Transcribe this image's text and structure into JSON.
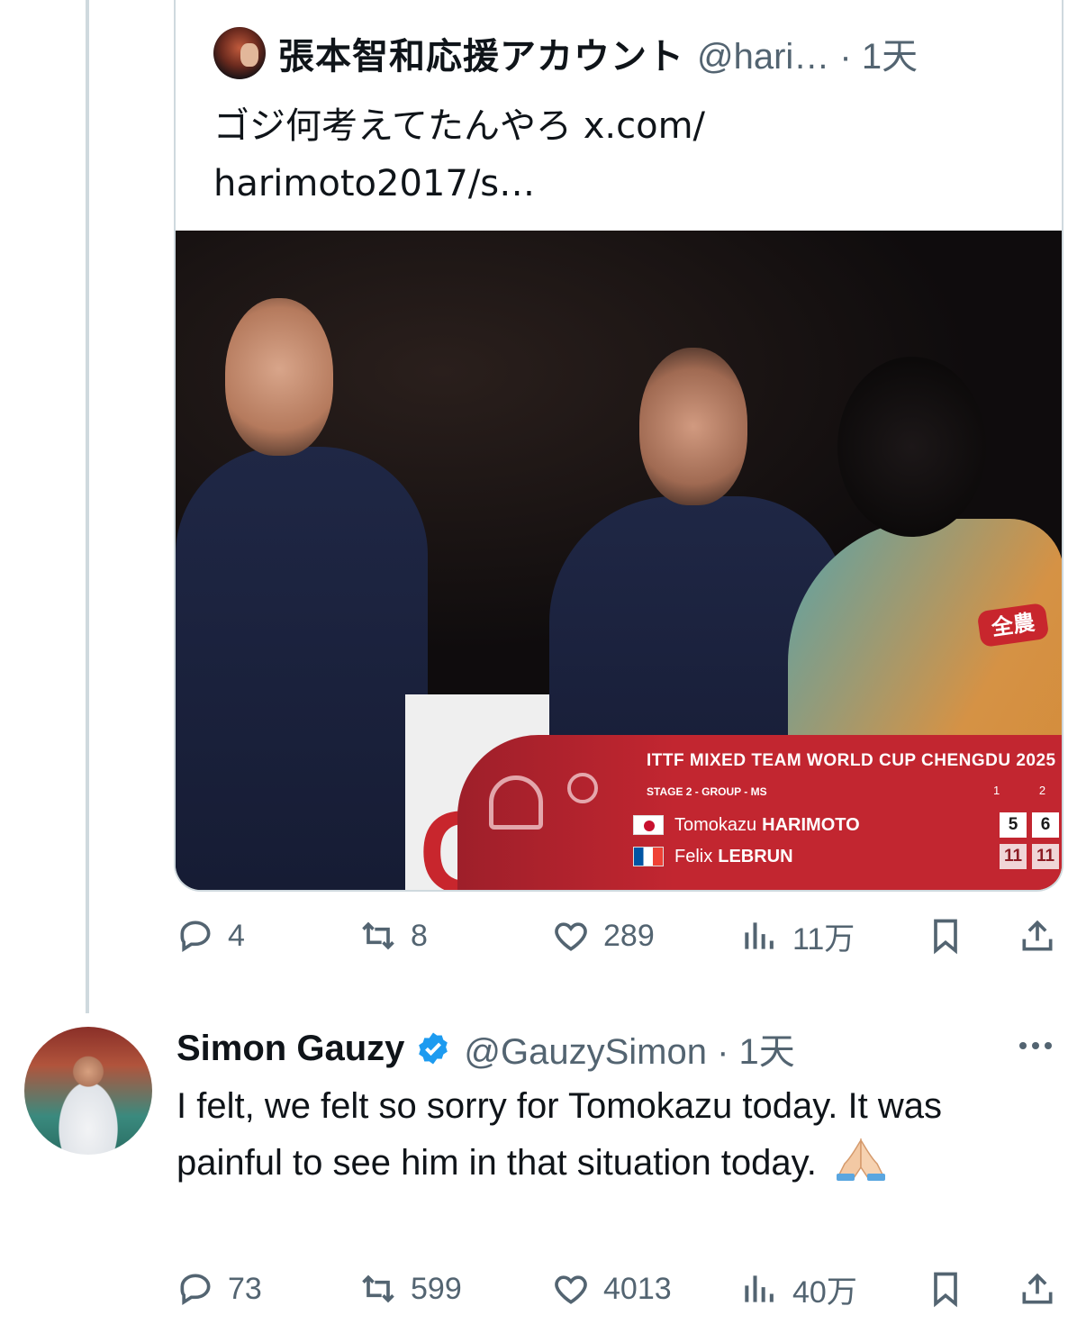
{
  "quote": {
    "author_name": "張本智和応援アカウント",
    "handle_time": "@hari… · 1天",
    "text": "ゴジ何考えてたんやろ x.com/ harimoto2017/s…",
    "media": {
      "shirt_text": "全農",
      "scoreboard": {
        "title": "ITTF MIXED TEAM WORLD CUP CHENGDU 2025",
        "stage": "STAGE 2 - GROUP - MS",
        "game_1": "1",
        "game_2": "2",
        "player1_first": "Tomokazu",
        "player1_last": "HARIMOTO",
        "player1_g1": "5",
        "player1_g2": "6",
        "player2_first": "Felix",
        "player2_last": "LEBRUN",
        "player2_g1": "11",
        "player2_g2": "11"
      }
    },
    "actions": {
      "replies": "4",
      "reposts": "8",
      "likes": "289",
      "views": "11万"
    }
  },
  "reply": {
    "author_name": "Simon Gauzy",
    "handle_time": "@GauzySimon · 1天",
    "text": "I felt, we felt so sorry for Tomokazu today. It was painful to see him in that situation today.",
    "actions": {
      "replies": "73",
      "reposts": "599",
      "likes": "4013",
      "views": "40万"
    }
  },
  "colors": {
    "text_primary": "#0f1419",
    "text_secondary": "#536471",
    "verified_blue": "#1d9bf0",
    "border": "#cfd9de"
  },
  "icons": [
    "reply-icon",
    "repost-icon",
    "like-icon",
    "views-icon",
    "bookmark-icon",
    "share-icon",
    "verified-icon",
    "more-icon",
    "praying-hands-icon"
  ]
}
